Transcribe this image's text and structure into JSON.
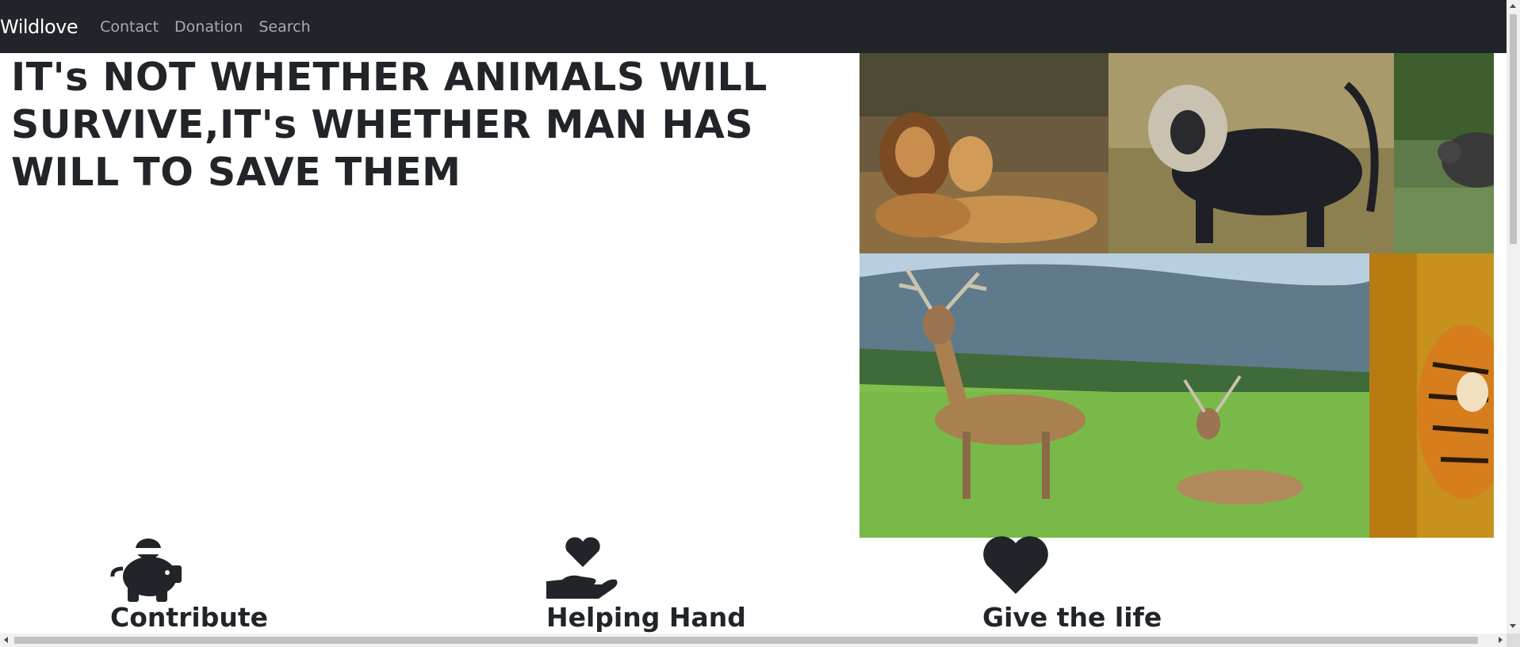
{
  "navbar": {
    "brand": "Wildlove",
    "links": [
      "Contact",
      "Donation",
      "Search"
    ]
  },
  "hero": {
    "headline": "IT's NOT WHETHER ANIMALS WILL SURVIVE,IT's WHETHER MAN HAS WILL TO SAVE THEM"
  },
  "gallery": {
    "images": [
      "lions",
      "lion-tailed-macaque",
      "rhino",
      "deer",
      "tiger"
    ]
  },
  "features": [
    {
      "title": "Contribute",
      "icon": "piggy-bank-icon"
    },
    {
      "title": "Helping Hand",
      "icon": "hand-holding-heart-icon"
    },
    {
      "title": "Give the life",
      "icon": "heart-icon"
    }
  ],
  "colors": {
    "navbar_bg": "#212529",
    "text": "#212529",
    "nav_link": "#a7abaf"
  }
}
